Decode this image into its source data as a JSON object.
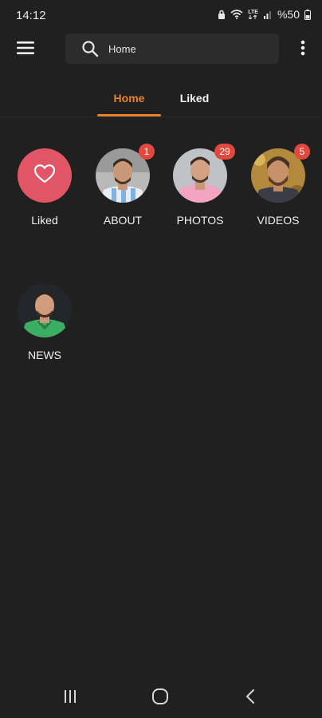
{
  "status_bar": {
    "time": "14:12",
    "network_label": "LTE",
    "battery": "%50"
  },
  "search": {
    "value": "Home",
    "placeholder": "Home"
  },
  "tabs": [
    {
      "label": "Home",
      "active": true
    },
    {
      "label": "Liked",
      "active": false
    }
  ],
  "categories": [
    {
      "label": "Liked",
      "icon": "heart-icon",
      "badge": null
    },
    {
      "label": "ABOUT",
      "badge": "1"
    },
    {
      "label": "PHOTOS",
      "badge": "29"
    },
    {
      "label": "VIDEOS",
      "badge": "5"
    },
    {
      "label": "NEWS",
      "badge": null
    }
  ],
  "colors": {
    "background": "#202020",
    "accent": "#e8822e",
    "liked_circle": "#e25567",
    "badge": "#e2483d",
    "search_box": "#2c2c2c"
  },
  "nav_bar": {
    "icons": [
      "recent-apps-icon",
      "home-icon",
      "back-icon"
    ]
  }
}
